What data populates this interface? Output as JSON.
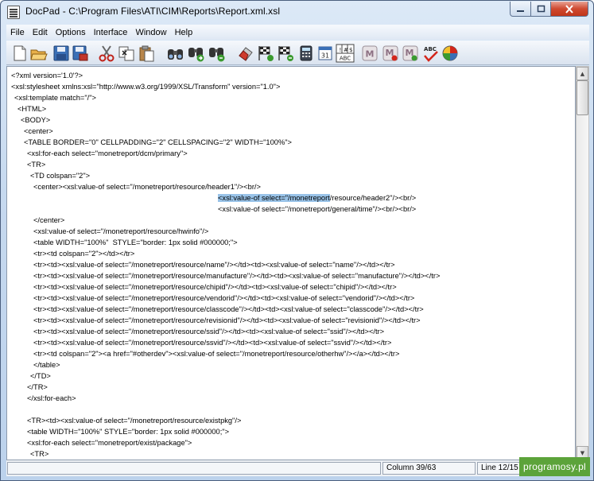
{
  "window": {
    "title": "DocPad - C:\\Program Files\\ATI\\CIM\\Reports\\Report.xml.xsl",
    "icon": "notepad-icon"
  },
  "menu": [
    {
      "label": "File"
    },
    {
      "label": "Edit"
    },
    {
      "label": "Options"
    },
    {
      "label": "Interface"
    },
    {
      "label": "Window"
    },
    {
      "label": "Help"
    }
  ],
  "toolbar": [
    {
      "name": "new-file-icon"
    },
    {
      "name": "open-folder-icon"
    },
    {
      "name": "save-icon"
    },
    {
      "name": "save-as-icon"
    },
    {
      "name": "cut-icon"
    },
    {
      "name": "copy-icon"
    },
    {
      "name": "paste-icon"
    },
    {
      "name": "find-icon"
    },
    {
      "name": "find-next-icon"
    },
    {
      "name": "replace-icon"
    },
    {
      "name": "eraser-icon"
    },
    {
      "name": "spell-flag-icon"
    },
    {
      "name": "spell-flag-next-icon"
    },
    {
      "name": "calculator-icon"
    },
    {
      "name": "calendar-icon",
      "text": "31"
    },
    {
      "name": "character-map-icon",
      "text": "ABC"
    },
    {
      "name": "macro-m-icon",
      "text": "M"
    },
    {
      "name": "macro-record-icon",
      "text": "M"
    },
    {
      "name": "macro-play-icon",
      "text": "M"
    },
    {
      "name": "spell-check-icon",
      "text": "ABC"
    },
    {
      "name": "color-wheel-icon"
    }
  ],
  "editor": {
    "lines": [
      {
        "indent": 0,
        "text": "<?xml version='1.0'?>"
      },
      {
        "indent": 0,
        "text": "<xsl:stylesheet xmlns:xsl=\"http://www.w3.org/1999/XSL/Transform\" version=\"1.0\">"
      },
      {
        "indent": 1,
        "text": "<xsl:template match=\"/\">"
      },
      {
        "indent": 2,
        "text": "<HTML>"
      },
      {
        "indent": 3,
        "text": "<BODY>"
      },
      {
        "indent": 4,
        "text": "<center>"
      },
      {
        "indent": 4,
        "text": "<TABLE BORDER=\"0\" CELLPADDING=\"2\" CELLSPACING=\"2\" WIDTH=\"100%\">"
      },
      {
        "indent": 5,
        "text": "<xsl:for-each select=\"monetreport/dcm/primary\">"
      },
      {
        "indent": 5,
        "text": "<TR>"
      },
      {
        "indent": 6,
        "text": "<TD colspan=\"2\">"
      },
      {
        "indent": 7,
        "text": "<center><xsl:value-of select=\"/monetreport/resource/header1\"/><br/>"
      },
      {
        "indent": 65,
        "pre": "",
        "sel": "<xsl:value-of select=\"/monetreport",
        "post": "/resource/header2\"/><br/>"
      },
      {
        "indent": 65,
        "text": "<xsl:value-of select=\"/monetreport/general/time\"/><br/><br/>"
      },
      {
        "indent": 7,
        "text": "</center>"
      },
      {
        "indent": 7,
        "text": "<xsl:value-of select=\"/monetreport/resource/hwinfo\"/>"
      },
      {
        "indent": 7,
        "text": "<table WIDTH=\"100%\"  STYLE=\"border: 1px solid #000000;\">"
      },
      {
        "indent": 7,
        "text": "<tr><td colspan=\"2\"></td></tr>"
      },
      {
        "indent": 7,
        "text": "<tr><td><xsl:value-of select=\"/monetreport/resource/name\"/></td><td><xsl:value-of select=\"name\"/></td></tr>"
      },
      {
        "indent": 7,
        "text": "<tr><td><xsl:value-of select=\"/monetreport/resource/manufacture\"/></td><td><xsl:value-of select=\"manufacture\"/></td></tr>"
      },
      {
        "indent": 7,
        "text": "<tr><td><xsl:value-of select=\"/monetreport/resource/chipid\"/></td><td><xsl:value-of select=\"chipid\"/></td></tr>"
      },
      {
        "indent": 7,
        "text": "<tr><td><xsl:value-of select=\"/monetreport/resource/vendorid\"/></td><td><xsl:value-of select=\"vendorid\"/></td></tr>"
      },
      {
        "indent": 7,
        "text": "<tr><td><xsl:value-of select=\"/monetreport/resource/classcode\"/></td><td><xsl:value-of select=\"classcode\"/></td></tr>"
      },
      {
        "indent": 7,
        "text": "<tr><td><xsl:value-of select=\"/monetreport/resource/revisionid\"/></td><td><xsl:value-of select=\"revisionid\"/></td></tr>"
      },
      {
        "indent": 7,
        "text": "<tr><td><xsl:value-of select=\"/monetreport/resource/ssid\"/></td><td><xsl:value-of select=\"ssid\"/></td></tr>"
      },
      {
        "indent": 7,
        "text": "<tr><td><xsl:value-of select=\"/monetreport/resource/ssvid\"/></td><td><xsl:value-of select=\"ssvid\"/></td></tr>"
      },
      {
        "indent": 7,
        "text": "<tr><td colspan=\"2\"><a href=\"#otherdev\"><xsl:value-of select=\"/monetreport/resource/otherhw\"/></a></td></tr>"
      },
      {
        "indent": 7,
        "text": "</table>"
      },
      {
        "indent": 6,
        "text": "</TD>"
      },
      {
        "indent": 5,
        "text": "</TR>"
      },
      {
        "indent": 5,
        "text": "</xsl:for-each>"
      },
      {
        "indent": 0,
        "text": ""
      },
      {
        "indent": 5,
        "text": "<TR><td><xsl:value-of select=\"/monetreport/resource/existpkg\"/>"
      },
      {
        "indent": 5,
        "text": "<table WIDTH=\"100%\" STYLE=\"border: 1px solid #000000;\">"
      },
      {
        "indent": 5,
        "text": "<xsl:for-each select=\"monetreport/exist/package\">"
      },
      {
        "indent": 6,
        "text": "<TR>"
      }
    ]
  },
  "scrollbar": {
    "up_arrow": "▲",
    "down_arrow": "▼"
  },
  "status": {
    "pane1": "",
    "column": "Column 39/63",
    "line": "Line 12/15"
  },
  "watermark": "programosy.pl"
}
